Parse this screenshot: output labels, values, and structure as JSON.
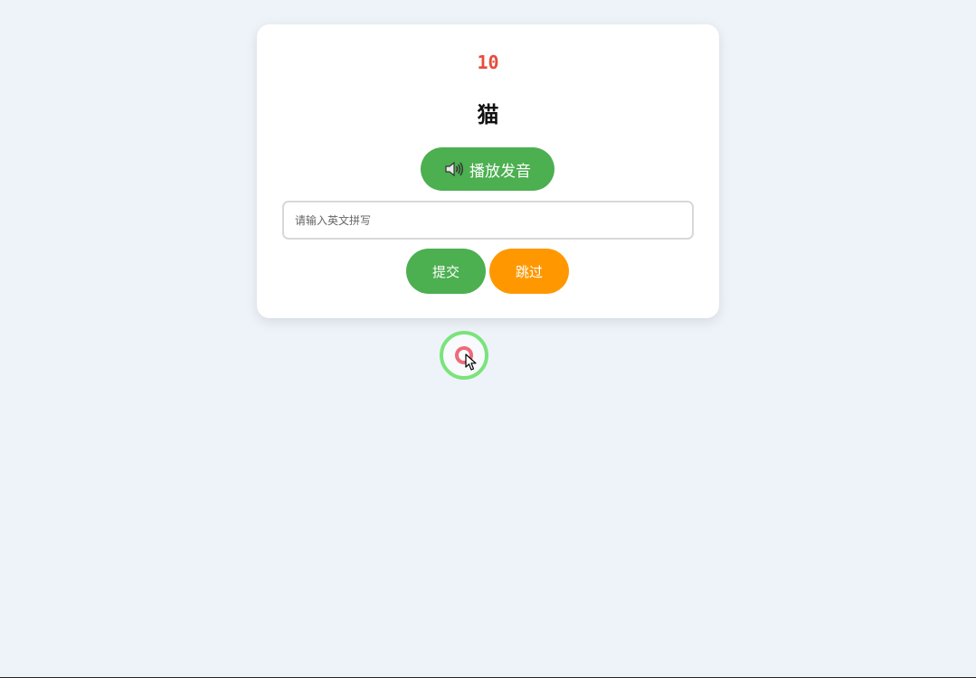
{
  "quiz": {
    "timer": "10",
    "word": "猫",
    "play_label": "播放发音",
    "input_placeholder": "请输入英文拼写",
    "input_value": "",
    "submit_label": "提交",
    "skip_label": "跳过"
  },
  "icons": {
    "speaker": "speaker-icon",
    "cursor": "mouse-pointer-icon"
  },
  "colors": {
    "background": "#edf3f9",
    "card": "#ffffff",
    "timer": "#e74c3c",
    "primary_green": "#4caf50",
    "skip_orange": "#ff9800"
  }
}
